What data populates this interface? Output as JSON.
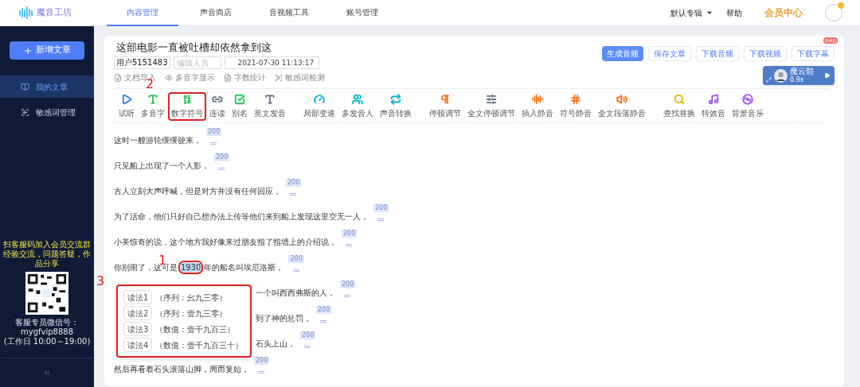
{
  "app": {
    "logo_text": "魔音工坊"
  },
  "top_nav": {
    "tabs": [
      {
        "label": "内容管理",
        "selected": true
      },
      {
        "label": "声音商店",
        "selected": false
      },
      {
        "label": "音视频工具",
        "selected": false
      },
      {
        "label": "账号管理",
        "selected": false
      }
    ],
    "album": "默认专辑",
    "help": "帮助",
    "vip": "会员中心"
  },
  "sidebar": {
    "new_button": "新增文章",
    "items": [
      {
        "label": "我的文章",
        "selected": true
      },
      {
        "label": "敏感词管理",
        "selected": false
      }
    ],
    "promo": [
      "扫客服码加入会员交流群",
      "经验交流，问题答疑，作品分享"
    ],
    "contact": [
      "客服专员微信号：",
      "mygfvip8888",
      "(工作日 10:00～19:00)"
    ]
  },
  "article": {
    "title": "这部电影一直被吐槽却依然拿到这",
    "author": "用户5151483",
    "editor_placeholder": "编辑人员",
    "datetime": "2021-07-30 11:13:17",
    "utilities": [
      "文档导入",
      "多音字显示",
      "字数统计",
      "敏感词检测"
    ],
    "actions": [
      {
        "label": "生成音频",
        "primary": true
      },
      {
        "label": "保存文章",
        "primary": false
      },
      {
        "label": "下载音频",
        "primary": false
      },
      {
        "label": "下载视频",
        "primary": false
      },
      {
        "label": "下载字幕",
        "primary": false,
        "badge": "svip"
      }
    ],
    "voice": {
      "name": "魔云熙",
      "speed": "0.9x"
    },
    "toolbar": [
      [
        {
          "label": "试听",
          "color": "#3b82f6",
          "selected": false
        },
        {
          "label": "多音字",
          "color": "#22c55e",
          "selected": false
        },
        {
          "label": "数字符号",
          "color": "#22c55e",
          "selected": true
        },
        {
          "label": "连读",
          "color": "#6b7280",
          "selected": false
        },
        {
          "label": "别名",
          "color": "#22c55e",
          "selected": false
        },
        {
          "label": "英文发音",
          "color": "#6b7280",
          "selected": false
        }
      ],
      [
        {
          "label": "局部变速",
          "color": "#06b6d4",
          "selected": false
        },
        {
          "label": "多发音人",
          "color": "#06b6d4",
          "selected": false
        },
        {
          "label": "声音转换",
          "color": "#06b6d4",
          "selected": false
        }
      ],
      [
        {
          "label": "停顿调节",
          "color": "#f97316",
          "selected": false
        },
        {
          "label": "全文停顿调节",
          "color": "#6b7280",
          "selected": false
        },
        {
          "label": "插入静音",
          "color": "#f97316",
          "selected": false
        },
        {
          "label": "符号静音",
          "color": "#f97316",
          "selected": false
        },
        {
          "label": "全文段落静音",
          "color": "#f97316",
          "selected": false
        }
      ],
      [
        {
          "label": "查找替换",
          "color": "#eab308",
          "selected": false
        },
        {
          "label": "特效音",
          "color": "#a855f7",
          "selected": false
        },
        {
          "label": "背景音乐",
          "color": "#a855f7",
          "selected": false
        }
      ]
    ],
    "lines": [
      {
        "text": "这时一艘游轮缓缓驶来，",
        "pause": "200",
        "covered": false
      },
      {
        "text": "只见船上出现了一个人影，",
        "pause": "200",
        "covered": false
      },
      {
        "text": "古人立刻大声呼喊，但是对方并没有任何回应，",
        "pause": "200",
        "covered": false
      },
      {
        "text": "为了活命，他们只好自己想办法上传等他们来到船上发现这里空无一人，",
        "pause": "200",
        "covered": false
      },
      {
        "text": "小美惊奇的说，这个地方我好像来过朋友指了指墙上的介绍说，",
        "pause": "200",
        "covered": false
      },
      {
        "text": "你别闹了，这可是",
        "highlight": "1930",
        "text_after": "年的船名叫埃厄洛斯，",
        "pause": "200",
        "covered": false
      },
      {
        "text": "一个叫西西弗斯的人，",
        "pause": "200",
        "covered": true
      },
      {
        "text": "到了神的惩罚，",
        "pause": "200",
        "covered": true
      },
      {
        "text": "石头上山，",
        "pause": "200",
        "covered": true
      },
      {
        "text": "然后再看着石头滚落山脚，周而复始，",
        "pause": "200",
        "covered": false
      }
    ],
    "readings": [
      {
        "button": "读法1",
        "text": "（序列：幺九三零）"
      },
      {
        "button": "读法2",
        "text": "（序列：壹九三零）"
      },
      {
        "button": "读法3",
        "text": "（数值：壹千九百三）"
      },
      {
        "button": "读法4",
        "text": "（数值：壹千九百三十）"
      }
    ]
  },
  "annotations": [
    "1",
    "2",
    "3"
  ]
}
